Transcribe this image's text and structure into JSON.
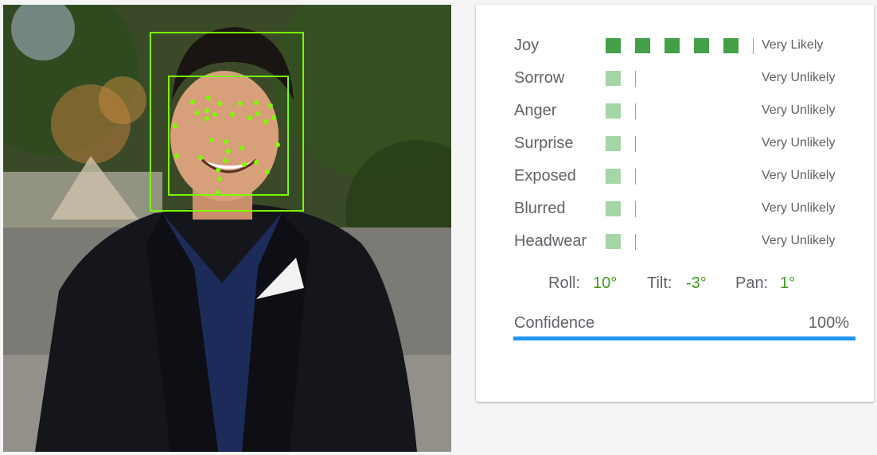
{
  "colors": {
    "likelihood_strong": "#43a047",
    "likelihood_weak": "#a5d6a7",
    "angle_value": "#3e9a1d",
    "confidence_bar": "#2196f3",
    "face_box": "#7cfc00"
  },
  "attributes": [
    {
      "label": "Joy",
      "likelihood": "Very Likely",
      "level": 5
    },
    {
      "label": "Sorrow",
      "likelihood": "Very Unlikely",
      "level": 1
    },
    {
      "label": "Anger",
      "likelihood": "Very Unlikely",
      "level": 1
    },
    {
      "label": "Surprise",
      "likelihood": "Very Unlikely",
      "level": 1
    },
    {
      "label": "Exposed",
      "likelihood": "Very Unlikely",
      "level": 1
    },
    {
      "label": "Blurred",
      "likelihood": "Very Unlikely",
      "level": 1
    },
    {
      "label": "Headwear",
      "likelihood": "Very Unlikely",
      "level": 1
    }
  ],
  "angles": {
    "roll_label": "Roll:",
    "roll_value": "10°",
    "tilt_label": "Tilt:",
    "tilt_value": "-3°",
    "pan_label": "Pan:",
    "pan_value": "1°"
  },
  "confidence": {
    "label": "Confidence",
    "value": "100%",
    "fraction": 1.0
  }
}
